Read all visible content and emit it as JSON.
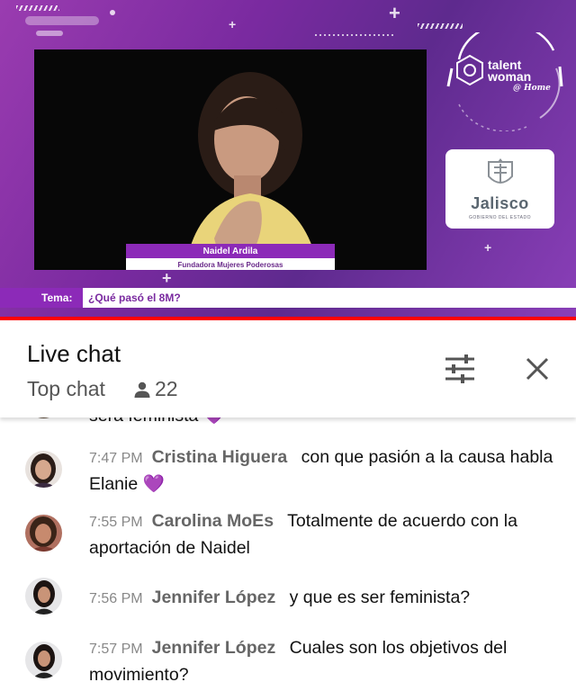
{
  "video": {
    "speaker_name": "Naidel Ardila",
    "speaker_role": "Fundadora Mujeres Poderosas",
    "topic_label": "Tema:",
    "topic_text": "¿Qué pasó el 8M?",
    "brand": {
      "line1": "talent",
      "line2": "woman",
      "line3": "@ Home"
    },
    "sponsor": {
      "name": "Jalisco",
      "subtitle": "GOBIERNO DEL ESTADO"
    },
    "progress_fraction": 1.0,
    "accent_color": "#8c2ab8"
  },
  "chat": {
    "title": "Live chat",
    "mode": "Top chat",
    "viewer_count": "22",
    "icons": {
      "filter": "filter-sliders-icon",
      "close": "close-icon",
      "viewers": "person-icon"
    }
  },
  "messages": [
    {
      "time": "",
      "author": "",
      "text": "sera feminista",
      "emoji": "💜"
    },
    {
      "time": "7:47 PM",
      "author": "Cristina Higuera",
      "text": "con que pasión a la causa habla Elanie",
      "emoji": "💜"
    },
    {
      "time": "7:55 PM",
      "author": "Carolina MoEs",
      "text": "Totalmente de acuerdo con la aportación de Naidel",
      "emoji": ""
    },
    {
      "time": "7:56 PM",
      "author": "Jennifer López",
      "text": "y que es ser feminista?",
      "emoji": ""
    },
    {
      "time": "7:57 PM",
      "author": "Jennifer López",
      "text": "Cuales son los objetivos del movimiento?",
      "emoji": ""
    }
  ]
}
